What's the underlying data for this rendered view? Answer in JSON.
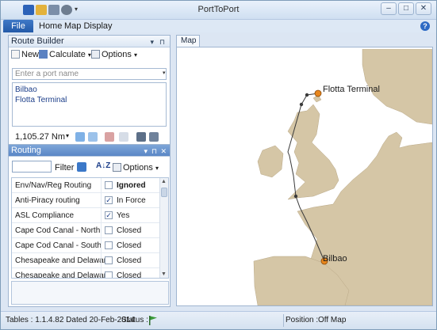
{
  "app": {
    "title": "PortToPort"
  },
  "menu": {
    "file": "File",
    "home": "Home",
    "map_display": "Map Display"
  },
  "route_builder": {
    "title": "Route Builder",
    "toolbar": {
      "new": "New",
      "calculate": "Calculate",
      "options": "Options"
    },
    "port_input_placeholder": "Enter a port name",
    "ports": [
      "Bilbao",
      "Flotta Terminal"
    ],
    "distance": "1,105.27 Nm"
  },
  "routing": {
    "title": "Routing",
    "filter_label": "Filter",
    "options": "Options",
    "rows": [
      {
        "name": "Env/Nav/Reg Routing",
        "checked": false,
        "state": "Ignored",
        "bold": true
      },
      {
        "name": "Anti-Piracy routing",
        "checked": true,
        "state": "In Force"
      },
      {
        "name": "ASL Compliance",
        "checked": true,
        "state": "Yes"
      },
      {
        "name": "Cape Cod Canal - North",
        "checked": false,
        "state": "Closed"
      },
      {
        "name": "Cape Cod Canal - South",
        "checked": false,
        "state": "Closed"
      },
      {
        "name": "Chesapeake and Delaware",
        "checked": false,
        "state": "Closed"
      },
      {
        "name": "Chesapeake and Delaware",
        "checked": false,
        "state": "Closed"
      }
    ]
  },
  "map": {
    "tab": "Map",
    "labels": {
      "origin": "Flotta Terminal",
      "destination": "Bilbao"
    },
    "colors": {
      "sea": "#ffffff",
      "land": "#d5c6a6",
      "route": "#3a3a3a",
      "port": "#e8861c"
    }
  },
  "status": {
    "tables": "Tables : 1.1.4.82 Dated 20-Feb-2014",
    "status_label": "Status :",
    "position_label": "Position :",
    "position_value": "Off Map"
  }
}
